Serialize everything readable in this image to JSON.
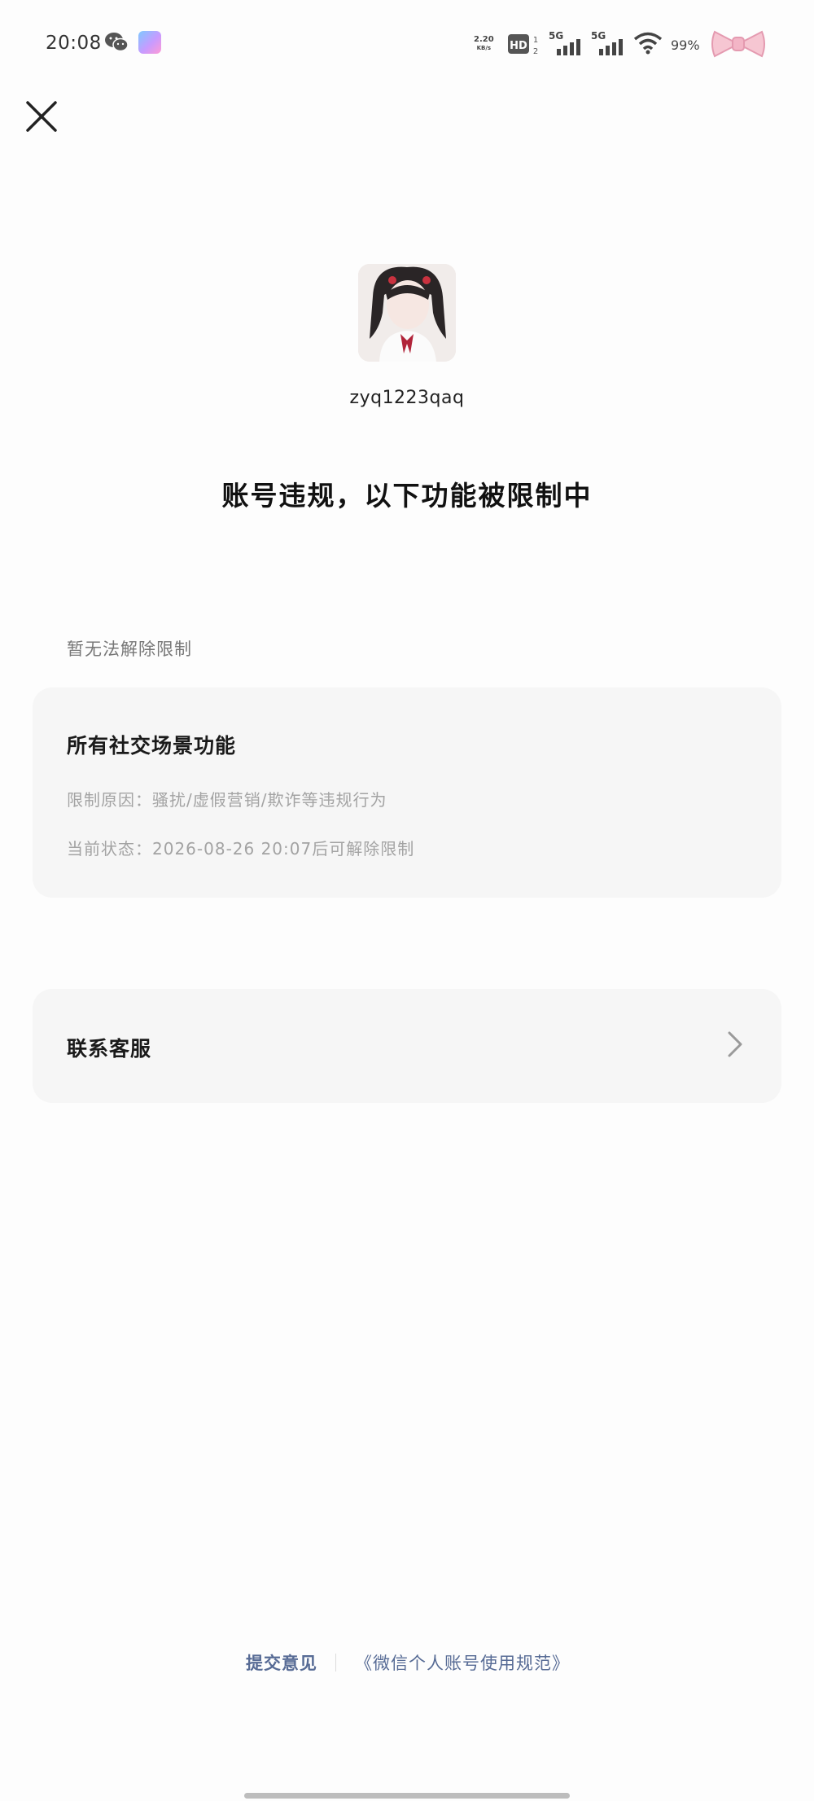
{
  "status_bar": {
    "time": "20:08",
    "net_speed_value": "2.20",
    "net_speed_unit": "KB/s",
    "signal_1_label": "5G",
    "signal_2_label": "5G",
    "battery": "99%",
    "icons": [
      "wechat-icon",
      "app-badge-icon",
      "hd-icon",
      "signal-icon",
      "signal-icon",
      "wifi-icon",
      "bow-icon"
    ]
  },
  "close_icon": "close-icon",
  "profile": {
    "username": "zyq1223qaq"
  },
  "headline": "账号违规，以下功能被限制中",
  "section_caption": "暂无法解除限制",
  "restriction_card": {
    "title": "所有社交场景功能",
    "reason": "限制原因：骚扰/虚假营销/欺诈等违规行为",
    "status": "当前状态：2026-08-26  20:07后可解除限制"
  },
  "contact": {
    "label": "联系客服"
  },
  "footer": {
    "feedback": "提交意见",
    "policy": "《微信个人账号使用规范》"
  },
  "colors": {
    "link": "#576b95",
    "card_bg": "#f6f6f6",
    "secondary_text": "#a3a3a3"
  }
}
